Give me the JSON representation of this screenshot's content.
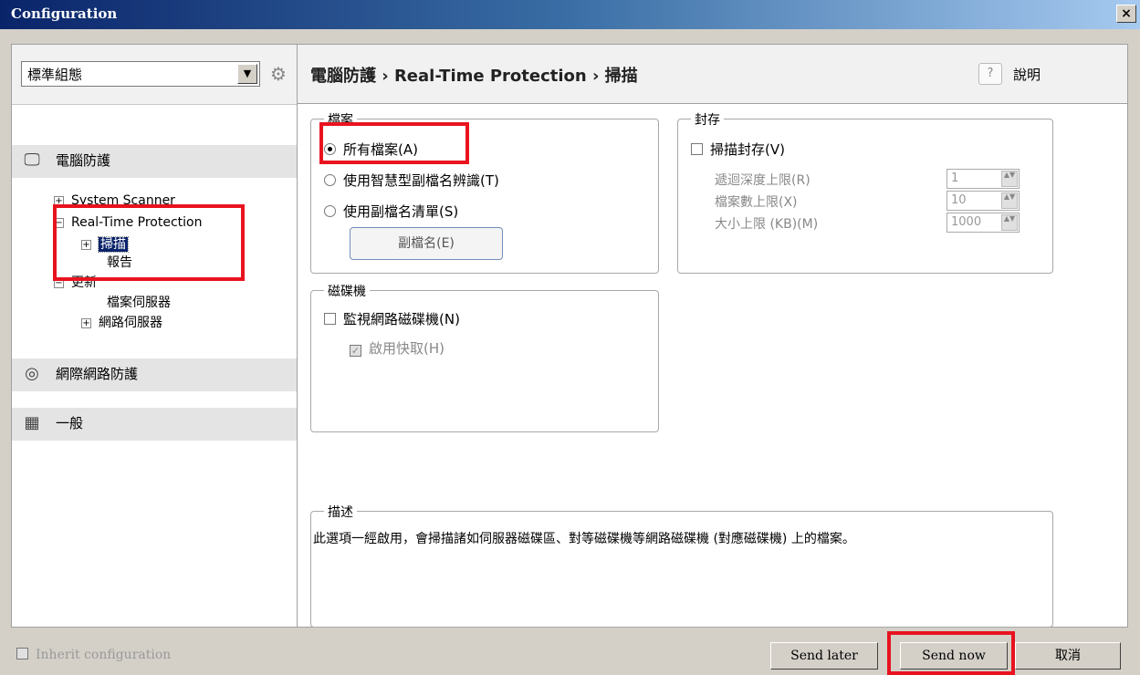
{
  "window": {
    "title": "Configuration",
    "close_label": "×"
  },
  "left": {
    "profile": "標準組態",
    "categories": [
      {
        "label": "電腦防護",
        "icon": "monitor-icon"
      },
      {
        "label": "網際網路防護",
        "icon": "globe-icon"
      },
      {
        "label": "一般",
        "icon": "calendar-icon"
      }
    ],
    "tree": {
      "system_scanner": "System Scanner",
      "realtime": "Real-Time Protection",
      "scan": "掃描",
      "report": "報告",
      "update": "更新",
      "file_server": "檔案伺服器",
      "web_server": "網路伺服器"
    },
    "expand_glyph": "+",
    "collapse_glyph": "−"
  },
  "header": {
    "breadcrumb": "電腦防護 › Real-Time Protection › 掃描",
    "help_icon": "?",
    "help_label": "說明"
  },
  "files_group": {
    "label": "檔案",
    "options": [
      "所有檔案(A)",
      "使用智慧型副檔名辨識(T)",
      "使用副檔名清單(S)"
    ],
    "selected": 0,
    "extensions_button": "副檔名(E)"
  },
  "archive_group": {
    "label": "封存",
    "scan_archives": "掃描封存(V)",
    "recursion_label": "遞迴深度上限(R)",
    "recursion_value": "1",
    "files_label": "檔案數上限(X)",
    "files_value": "10",
    "size_label": "大小上限 (KB)(M)",
    "size_value": "1000"
  },
  "drives_group": {
    "label": "磁碟機",
    "monitor_network": "監視網路磁碟機(N)",
    "enable_cache": "啟用快取(H)",
    "check_mark": "✓"
  },
  "description": {
    "label": "描述",
    "text": "此選項一經啟用，會掃描諸如伺服器磁碟區、對等磁碟機等網路磁碟機 (對應磁碟機) 上的檔案。"
  },
  "footer": {
    "inherit": "Inherit configuration",
    "send_later": "Send later",
    "send_now": "Send now",
    "cancel": "取消"
  },
  "colors": {
    "highlight_box": "#e8131f",
    "title_bar": "#0a246a"
  }
}
